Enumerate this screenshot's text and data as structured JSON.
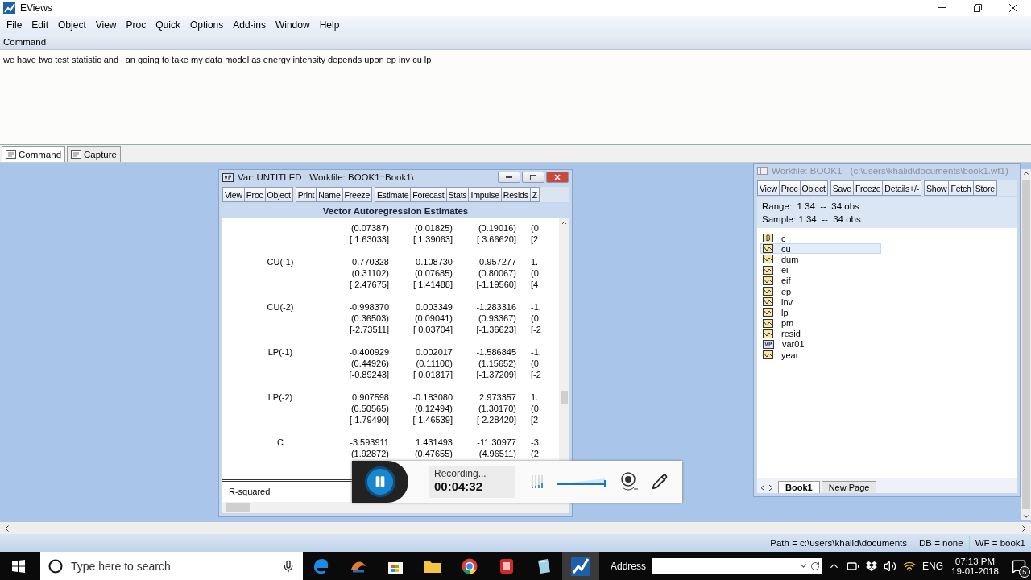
{
  "window": {
    "title": "EViews"
  },
  "menu": [
    "File",
    "Edit",
    "Object",
    "View",
    "Proc",
    "Quick",
    "Options",
    "Add-ins",
    "Window",
    "Help"
  ],
  "command": {
    "title": "Command",
    "text": "we have two test statistic and i an going to take my data model as energy intensity depends upon ep inv cu lp"
  },
  "command_tabs": [
    {
      "label": "Command",
      "selected": true
    },
    {
      "label": "Capture",
      "selected": false
    }
  ],
  "var_window": {
    "title": "Var: UNTITLED   Workfile: BOOK1::Book1\\",
    "toolbar": [
      [
        "View",
        "Proc",
        "Object"
      ],
      [
        "Print",
        "Name",
        "Freeze"
      ],
      [
        "Estimate",
        "Forecast",
        "Stats",
        "Impulse",
        "Resids",
        "Z"
      ]
    ],
    "heading": "Vector Autoregression Estimates",
    "rows": [
      {
        "columns": [
          [
            "(0.07387)",
            "[ 1.63033]"
          ],
          [
            "(0.01825)",
            "[ 1.39063]"
          ],
          [
            "(0.19016)",
            "[ 3.66620]"
          ],
          [
            "(0",
            "[2"
          ]
        ]
      },
      {
        "label": "CU(-1)",
        "columns": [
          [
            "0.770328",
            "(0.31102)",
            "[ 2.47675]"
          ],
          [
            "0.108730",
            "(0.07685)",
            "[ 1.41488]"
          ],
          [
            "-0.957277",
            "(0.80067)",
            "[-1.19560]"
          ],
          [
            "1.",
            "(0",
            "[4"
          ]
        ]
      },
      {
        "label": "CU(-2)",
        "columns": [
          [
            "-0.998370",
            "(0.36503)",
            "[-2.73511]"
          ],
          [
            "0.003349",
            "(0.09041)",
            "[ 0.03704]"
          ],
          [
            "-1.283316",
            "(0.93367)",
            "[-1.36623]"
          ],
          [
            "-1.",
            "(0",
            "[-2"
          ]
        ]
      },
      {
        "label": "LP(-1)",
        "columns": [
          [
            "-0.400929",
            "(0.44926)",
            "[-0.89243]"
          ],
          [
            "0.002017",
            "(0.11100)",
            "[ 0.01817]"
          ],
          [
            "-1.586845",
            "(1.15652)",
            "[-1.37209]"
          ],
          [
            "-1.",
            "(0",
            "[-2"
          ]
        ]
      },
      {
        "label": "LP(-2)",
        "columns": [
          [
            "0.907598",
            "(0.50565)",
            "[ 1.79490]"
          ],
          [
            "-0.183080",
            "(0.12494)",
            "[-1.46539]"
          ],
          [
            "2.973357",
            "(1.30170)",
            "[ 2.28420]"
          ],
          [
            "1.",
            "(0",
            "[2"
          ]
        ]
      },
      {
        "label": "C",
        "columns": [
          [
            "-3.593911",
            "(1.92872)"
          ],
          [
            "1.431493",
            "(0.47655)"
          ],
          [
            "-11.30977",
            "(4.96511)"
          ],
          [
            "-3.",
            "(2"
          ]
        ]
      }
    ],
    "footer": [
      "R-squared"
    ]
  },
  "workfile_window": {
    "title": "Workfile: BOOK1 - (c:\\users\\khalid\\documents\\book1.wf1)",
    "toolbar": [
      [
        "View",
        "Proc",
        "Object"
      ],
      [
        "Save",
        "Freeze",
        "Details+/-"
      ],
      [
        "Show",
        "Fetch",
        "Store"
      ]
    ],
    "range": "Range:  1 34  --  34 obs",
    "sample": "Sample: 1 34  --  34 obs",
    "objects": [
      {
        "name": "c",
        "kind": "scalar",
        "selected": false
      },
      {
        "name": "cu",
        "kind": "series",
        "selected": true
      },
      {
        "name": "dum",
        "kind": "series",
        "selected": false
      },
      {
        "name": "ei",
        "kind": "series",
        "selected": false
      },
      {
        "name": "eif",
        "kind": "series",
        "selected": false
      },
      {
        "name": "ep",
        "kind": "series",
        "selected": false
      },
      {
        "name": "inv",
        "kind": "series",
        "selected": false
      },
      {
        "name": "lp",
        "kind": "series",
        "selected": false
      },
      {
        "name": "pm",
        "kind": "series",
        "selected": false
      },
      {
        "name": "resid",
        "kind": "series",
        "selected": false
      },
      {
        "name": "var01",
        "kind": "var",
        "selected": false
      },
      {
        "name": "year",
        "kind": "series",
        "selected": false
      }
    ],
    "page_tabs": [
      {
        "label": "Book1",
        "selected": true
      },
      {
        "label": "New Page",
        "selected": false
      }
    ]
  },
  "recorder": {
    "status": "Recording...",
    "time": "00:04:32"
  },
  "status_bar": [
    "Path = c:\\users\\khalid\\documents",
    "DB = none",
    "WF = book1"
  ],
  "taskbar": {
    "search_placeholder": "Type here to search",
    "address_label": "Address",
    "language": "ENG",
    "time": "07:13 PM",
    "date": "19-01-2018",
    "notifications": "5"
  }
}
